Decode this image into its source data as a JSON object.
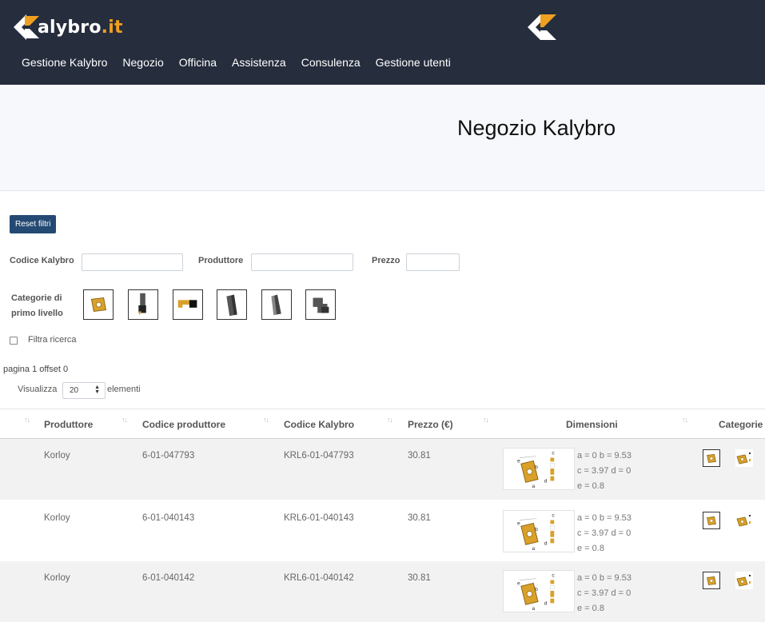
{
  "brand": {
    "name": "alybro",
    "tld": ".it"
  },
  "nav": [
    "Gestione Kalybro",
    "Negozio",
    "Officina",
    "Assistenza",
    "Consulenza",
    "Gestione utenti"
  ],
  "hero": {
    "title": "Negozio Kalybro"
  },
  "filters": {
    "reset_label": "Reset filtri",
    "codice_label": "Codice Kalybro",
    "produttore_label": "Produttore",
    "prezzo_label": "Prezzo",
    "categorie_label_1": "Categorie di",
    "categorie_label_2": "primo livello",
    "filtra_label": "Filtra ricerca",
    "category_icons": [
      "insert-icon",
      "tool-holder-icon",
      "boring-bar-icon",
      "endmill-icon",
      "drill-icon",
      "milling-block-icon"
    ]
  },
  "pager": {
    "info": "pagina 1 offset 0",
    "show_label": "Visualizza",
    "page_size": "20",
    "show_suffix": "elementi"
  },
  "table": {
    "headers": {
      "produttore": "Produttore",
      "codice_produttore": "Codice produttore",
      "codice_kalybro": "Codice Kalybro",
      "prezzo": "Prezzo (€)",
      "dimensioni": "Dimensioni",
      "categorie": "Categorie"
    },
    "rows": [
      {
        "produttore": "Korloy",
        "codice_produttore": "6-01-047793",
        "codice_kalybro": "KRL6-01-047793",
        "prezzo": "30.81",
        "dim_1": "a = 0 b = 9.53",
        "dim_2": "c = 3.97 d = 0",
        "dim_3": "e = 0.8"
      },
      {
        "produttore": "Korloy",
        "codice_produttore": "6-01-040143",
        "codice_kalybro": "KRL6-01-040143",
        "prezzo": "30.81",
        "dim_1": "a = 0 b = 9.53",
        "dim_2": "c = 3.97 d = 0",
        "dim_3": "e = 0.8"
      },
      {
        "produttore": "Korloy",
        "codice_produttore": "6-01-040142",
        "codice_kalybro": "KRL6-01-040142",
        "prezzo": "30.81",
        "dim_1": "a = 0 b = 9.53",
        "dim_2": "c = 3.97 d = 0",
        "dim_3": "e = 0.8"
      }
    ],
    "dim_letters": {
      "a": "a",
      "b": "b",
      "c": "c",
      "d": "d",
      "e": "e"
    }
  },
  "colors": {
    "navbar": "#262d3d",
    "accent": "#f0a020",
    "button": "#244a74",
    "insert_gold": "#d9a12a"
  }
}
